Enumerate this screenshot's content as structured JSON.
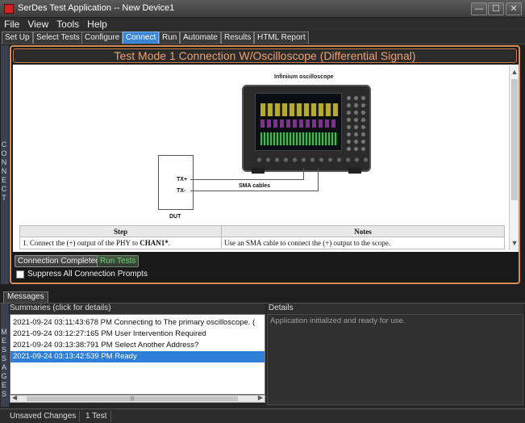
{
  "window": {
    "title": "SerDes Test Application -- New Device1",
    "minimize_glyph": "—",
    "maximize_glyph": "☐",
    "close_glyph": "✕"
  },
  "menu": [
    "File",
    "View",
    "Tools",
    "Help"
  ],
  "tabs": [
    {
      "label": "Set Up",
      "active": false
    },
    {
      "label": "Select Tests",
      "active": false
    },
    {
      "label": "Configure",
      "active": false
    },
    {
      "label": "Connect",
      "active": true
    },
    {
      "label": "Run",
      "active": false
    },
    {
      "label": "Automate",
      "active": false
    },
    {
      "label": "Results",
      "active": false
    },
    {
      "label": "HTML Report",
      "active": false
    }
  ],
  "side_labels": {
    "connect": "CONNECT",
    "messages": "MESSAGES"
  },
  "connect": {
    "banner": "Test Mode 1 Connection W/Oscilloscope (Differential Signal)",
    "diagram": {
      "scope_caption": "Infiniium oscilloscope",
      "tx_plus": "TX+",
      "tx_minus": "TX-",
      "cable_label": "SMA cables",
      "dut_label": "DUT"
    },
    "table": {
      "headers": [
        "Step",
        "Notes"
      ],
      "rows": [
        {
          "step_prefix": "1. Connect the (+) output of the PHY to ",
          "step_bold": "CHAN1*",
          "step_suffix": ".",
          "notes": "Use an SMA cable to connect the (+) output to the scope."
        }
      ]
    },
    "buttons": {
      "completed": "Connection Completed",
      "run_tests": "Run Tests"
    },
    "suppress_label": "Suppress All Connection Prompts",
    "suppress_checked": false
  },
  "messages": {
    "tab_label": "Messages",
    "summaries_header": "Summaries (click for details)",
    "details_header": "Details",
    "summaries": [
      {
        "text": "2021-09-24 03:11:43:678 PM Connecting to The primary oscilloscope. (",
        "selected": false
      },
      {
        "text": "2021-09-24 03:12:27:165 PM User Intervention Required",
        "selected": false
      },
      {
        "text": "2021-09-24 03:13:38:791 PM Select Another Address?",
        "selected": false
      },
      {
        "text": "2021-09-24 03:13:42:539 PM Ready",
        "selected": true
      }
    ],
    "details_text": "Application initialized and ready for use.",
    "hscroll_left": "◀",
    "hscroll_right": "▶",
    "hscroll_grip": "|||"
  },
  "vscroll": {
    "up": "▲",
    "down": "▼"
  },
  "status": {
    "unsaved": "Unsaved Changes",
    "count": "1 Test"
  },
  "colors": {
    "accent_tab": "#3a86d6",
    "banner_text": "#f0a070",
    "frame_border": "#d98c55",
    "selected_row": "#2f7fd8",
    "run_tests_text": "#6cd46c"
  }
}
